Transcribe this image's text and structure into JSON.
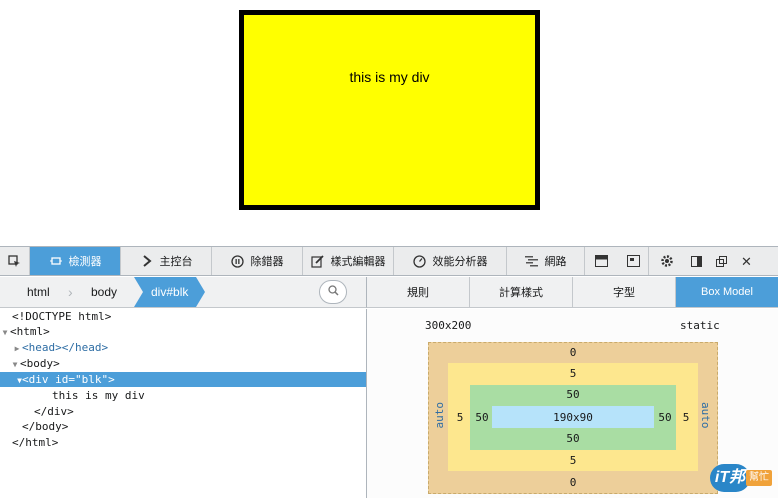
{
  "viewport": {
    "div_text": "this is my div",
    "div_bg": "#ffff00",
    "div_border": "#000000"
  },
  "toolbar": {
    "pick_icon": "pick-element-icon",
    "tools": [
      {
        "label": "檢測器",
        "icon": "inspector-icon",
        "active": true
      },
      {
        "label": "主控台",
        "icon": "console-icon"
      },
      {
        "label": "除錯器",
        "icon": "debugger-icon"
      },
      {
        "label": "樣式編輯器",
        "icon": "style-editor-icon"
      },
      {
        "label": "效能分析器",
        "icon": "profiler-icon"
      },
      {
        "label": "網路",
        "icon": "network-icon"
      }
    ],
    "right_icons": [
      "responsive-icon",
      "scratchpad-icon",
      "settings-icon",
      "dock-side-icon",
      "undock-icon",
      "close-icon"
    ]
  },
  "breadcrumbs": [
    "html",
    "body",
    "div#blk"
  ],
  "markup": {
    "lines": [
      {
        "text": "<!DOCTYPE html>"
      },
      {
        "text": "<html>"
      },
      {
        "text": "<head></head>"
      },
      {
        "text": "<body>"
      },
      {
        "text": "<div id=\"blk\">"
      },
      {
        "text": "this is my div"
      },
      {
        "text": "</div>"
      },
      {
        "text": "</body>"
      },
      {
        "text": "</html>"
      }
    ]
  },
  "side_tabs": [
    "規則",
    "計算樣式",
    "字型",
    "Box Model"
  ],
  "box_model": {
    "size": "300x200",
    "position": "static",
    "margin": {
      "top": "0",
      "bottom": "0",
      "left": "auto",
      "right": "auto"
    },
    "border": {
      "top": "5",
      "bottom": "5",
      "left": "5",
      "right": "5"
    },
    "padding": {
      "top": "50",
      "bottom": "50",
      "left": "50",
      "right": "50"
    },
    "content": "190x90"
  },
  "watermark": {
    "logo": "iT邦",
    "text": "幫忙"
  },
  "colors": {
    "accent": "#4c9ed9",
    "margin": "#edcf9a",
    "border": "#fde78e",
    "padding": "#a9dda3",
    "content": "#b6e3fa"
  }
}
